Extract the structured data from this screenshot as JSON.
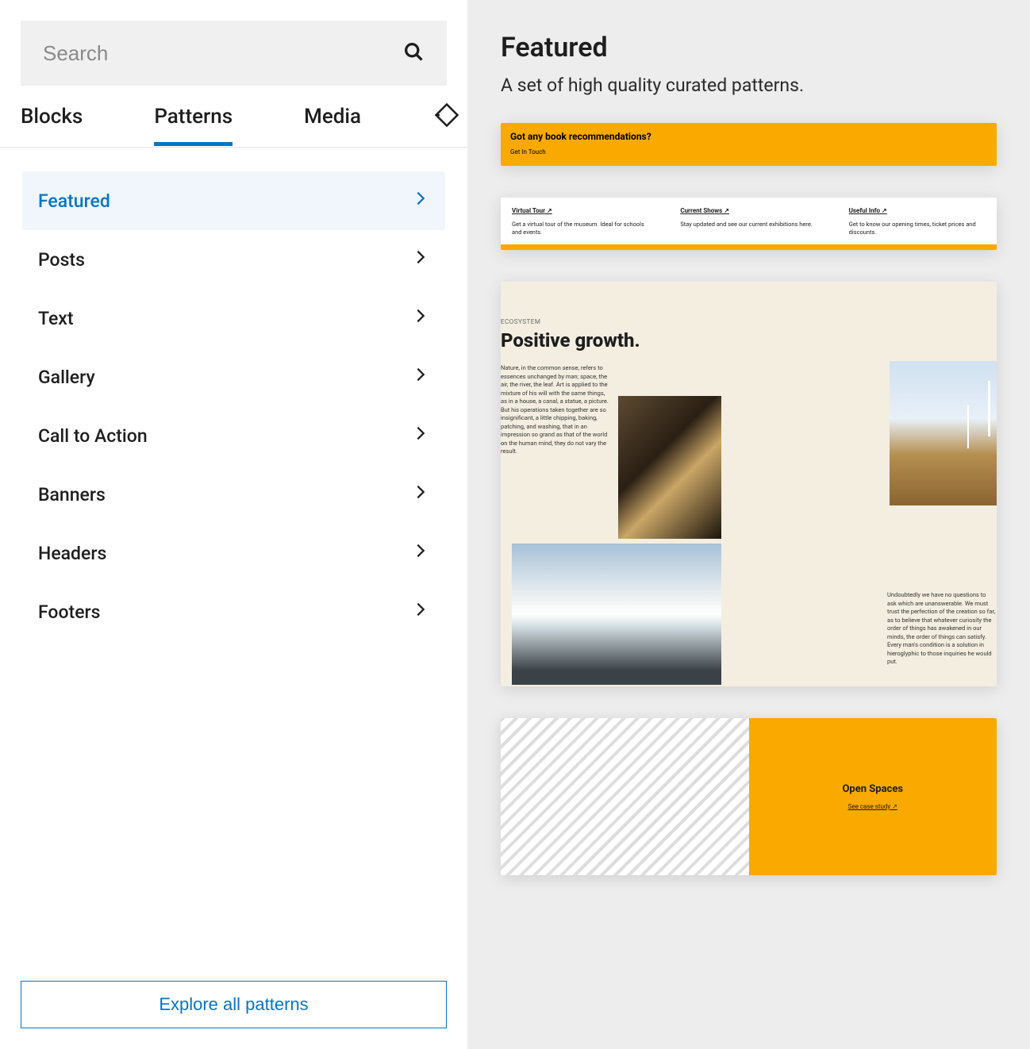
{
  "search": {
    "placeholder": "Search"
  },
  "tabs": {
    "blocks": "Blocks",
    "patterns": "Patterns",
    "media": "Media",
    "active": "patterns"
  },
  "categories": [
    {
      "label": "Featured",
      "active": true
    },
    {
      "label": "Posts",
      "active": false
    },
    {
      "label": "Text",
      "active": false
    },
    {
      "label": "Gallery",
      "active": false
    },
    {
      "label": "Call to Action",
      "active": false
    },
    {
      "label": "Banners",
      "active": false
    },
    {
      "label": "Headers",
      "active": false
    },
    {
      "label": "Footers",
      "active": false
    }
  ],
  "explore_label": "Explore all patterns",
  "preview": {
    "heading": "Featured",
    "description": "A set of high quality curated patterns."
  },
  "card1": {
    "question": "Got any book recommendations?",
    "cta": "Get In Touch"
  },
  "card2": {
    "cols": [
      {
        "title": "Virtual Tour ↗",
        "desc": "Get a virtual tour of the museum. Ideal for schools and events."
      },
      {
        "title": "Current Shows ↗",
        "desc": "Stay updated and see our current exhibitions here."
      },
      {
        "title": "Useful Info ↗",
        "desc": "Get to know our opening times, ticket prices and discounts."
      }
    ]
  },
  "card3": {
    "eyebrow": "ECOSYSTEM",
    "headline": "Positive growth.",
    "para1": "Nature, in the common sense, refers to essences unchanged by man; space, the air, the river, the leaf. Art is applied to the mixture of his will with the same things, as in a house, a canal, a statue, a picture. But his operations taken together are so insignificant, a little chipping, baking, patching, and washing, that in an impression so grand as that of the world on the human mind, they do not vary the result.",
    "para2": "Undoubtedly we have no questions to ask which are unanswerable. We must trust the perfection of the creation so far, as to believe that whatever curiosity the order of things has awakened in our minds, the order of things can satisfy. Every man's condition is a solution in hieroglyphic to those inquiries he would put."
  },
  "card4": {
    "title": "Open Spaces",
    "link": "See case study ↗"
  }
}
